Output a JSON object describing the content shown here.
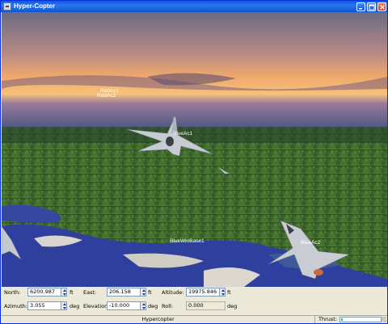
{
  "window": {
    "title": "Hyper-Copter",
    "controls": [
      "minimize-icon",
      "maximize-icon",
      "close-icon"
    ]
  },
  "scene": {
    "labels": {
      "redac1": "RedAc1",
      "redac2": "RedAc2",
      "blueac1": "BlueAc1",
      "blueac2": "BlueAc2",
      "bluebase": "BlueWinBase1"
    },
    "colors": {
      "sky_top": "#6a6a80",
      "sky_horizon": "#f2b56a",
      "terrain": "#3f6a2c",
      "water": "#2a3f9c"
    }
  },
  "controls": {
    "north": {
      "label": "North:",
      "value": "6200.987",
      "unit": "ft"
    },
    "east": {
      "label": "East:",
      "value": "206.158",
      "unit": "ft"
    },
    "altitude": {
      "label": "Altitude:",
      "value": "19975.846",
      "unit": "ft"
    },
    "azimuth": {
      "label": "Azimuth:",
      "value": "3.055",
      "unit": "deg"
    },
    "elevation": {
      "label": "Elevation:",
      "value": "-10.000",
      "unit": "deg"
    },
    "roll": {
      "label": "Roll:",
      "value": "0.000",
      "unit": "deg"
    }
  },
  "status": {
    "text": "Hypercopter",
    "thrust_label": "Thrust:",
    "thrust_fraction": 0.05
  }
}
